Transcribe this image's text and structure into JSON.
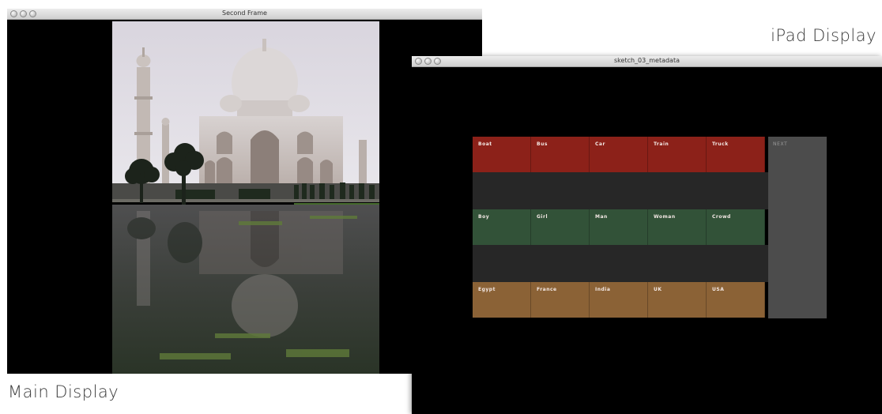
{
  "main_window": {
    "title": "Second Frame",
    "photo": {
      "subject": "Taj Mahal with reflection in water"
    }
  },
  "ipad_window": {
    "title": "sketch_03_metadata",
    "rows": [
      {
        "color": "#8c2119",
        "tags": [
          "Boat",
          "Bus",
          "Car",
          "Train",
          "Truck"
        ]
      },
      {
        "color": "#325238",
        "tags": [
          "Boy",
          "Girl",
          "Man",
          "Woman",
          "Crowd"
        ]
      },
      {
        "color": "#8b6236",
        "tags": [
          "Egypt",
          "France",
          "India",
          "UK",
          "USA"
        ]
      }
    ],
    "next_label": "NEXT"
  },
  "captions": {
    "ipad": "iPad Display",
    "main": "Main Display"
  }
}
